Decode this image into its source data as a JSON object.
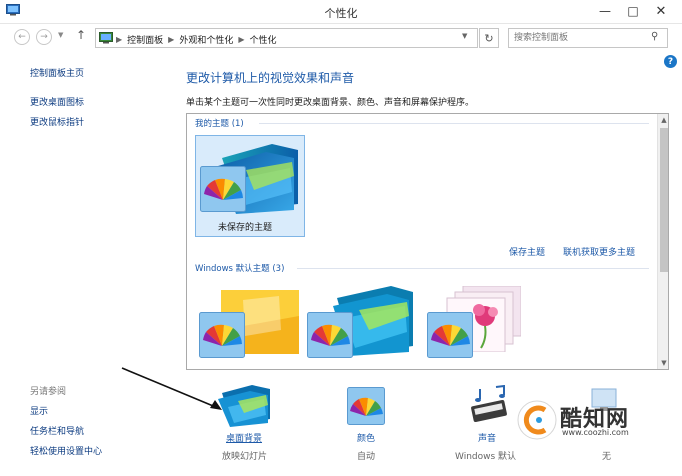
{
  "window": {
    "title": "个性化"
  },
  "nav": {
    "breadcrumbs": [
      "控制面板",
      "外观和个性化",
      "个性化"
    ],
    "search_placeholder": "搜索控制面板"
  },
  "left_pane": {
    "links": [
      "控制面板主页",
      "更改桌面图标",
      "更改鼠标指针"
    ],
    "see_also_label": "另请参阅",
    "see_also_links": [
      "显示",
      "任务栏和导航",
      "轻松使用设置中心"
    ]
  },
  "main": {
    "heading": "更改计算机上的视觉效果和声音",
    "description": "单击某个主题可一次性同时更改桌面背景、颜色、声音和屏幕保护程序。"
  },
  "themes": {
    "my_group_label": "我的主题 (1)",
    "my_themes": [
      {
        "name": "未保存的主题"
      }
    ],
    "save_link": "保存主题",
    "online_link": "联机获取更多主题",
    "windows_group_label": "Windows 默认主题 (3)"
  },
  "bottom": {
    "items": [
      {
        "label": "桌面背景",
        "sub": "放映幻灯片"
      },
      {
        "label": "颜色",
        "sub": "自动"
      },
      {
        "label": "声音",
        "sub": "Windows 默认"
      },
      {
        "label": "",
        "sub": "无"
      }
    ]
  },
  "watermark": {
    "brand": "酷知网",
    "url": "www.coozhi.com"
  },
  "colors": {
    "link": "#1e5aa8",
    "selection": "#d9ebfb",
    "help": "#1b76c7"
  }
}
